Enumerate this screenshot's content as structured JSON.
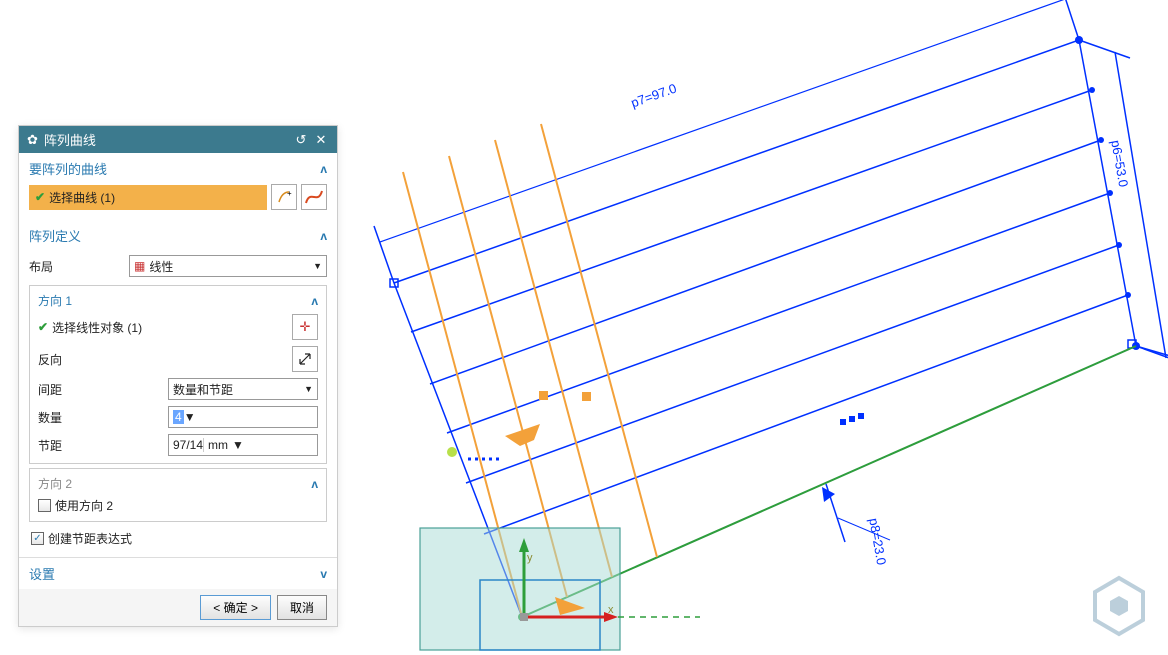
{
  "dialog": {
    "title": "阵列曲线",
    "sections": {
      "curves": {
        "header": "要阵列的曲线",
        "select_label": "选择曲线 (1)"
      },
      "definition": {
        "header": "阵列定义",
        "layout_label": "布局",
        "layout_value": "线性",
        "dir1": {
          "header": "方向 1",
          "select_label": "选择线性对象 (1)",
          "reverse_label": "反向",
          "spacing_label": "间距",
          "spacing_value": "数量和节距",
          "count_label": "数量",
          "count_value": "4",
          "pitch_label": "节距",
          "pitch_value": "97/14",
          "pitch_unit": "mm"
        },
        "dir2": {
          "header": "方向 2",
          "use_label": "使用方向 2"
        },
        "create_expr_label": "创建节距表达式"
      },
      "settings": {
        "header": "设置"
      }
    },
    "buttons": {
      "ok": "< 确定 >",
      "cancel": "取消"
    }
  },
  "dimensions": {
    "p7": "p7=97.0",
    "p6": "p6=53.0",
    "p8": "p8=23.0"
  },
  "axis": {
    "x": "x",
    "y": "y"
  }
}
